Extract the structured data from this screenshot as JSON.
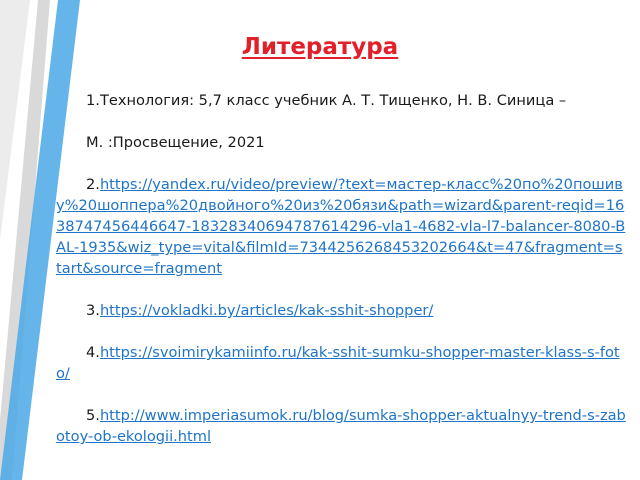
{
  "title": "Литература",
  "references": [
    {
      "number": "1.",
      "text": "Технология: 5,7 класс учебник А. Т. Тищенко, Н. В. Синица –",
      "text_line2": "М. :Просвещение, 2021"
    },
    {
      "number": "2.",
      "url": "https://yandex.ru/video/preview/?text=мастер-класс%20по%20пошиву%20шоппера%20двойного%20из%20бязи&path=wizard&parent-reqid=1638747456446647-18328340694787614296-vla1-4682-vla-l7-balancer-8080-BAL-1935&wiz_type=vital&filmId=7344256268453202664&t=47&fragment=start&source=fragment"
    },
    {
      "number": "3.",
      "url": "https://vokladki.by/articles/kak-sshit-shopper/"
    },
    {
      "number": "4.",
      "url": "https://svoimirykamiinfo.ru/kak-sshit-sumku-shopper-master-klass-s-foto/"
    },
    {
      "number": "5.",
      "url": "http://www.imperiasumok.ru/blog/sumka-shopper-aktualnyy-trend-s-zabotoy-ob-ekologii.html"
    }
  ],
  "colors": {
    "title": "#e2202a",
    "link": "#1f74c8",
    "deco_light": "#d3d3d3",
    "deco_blue": "#4aa8e6"
  }
}
